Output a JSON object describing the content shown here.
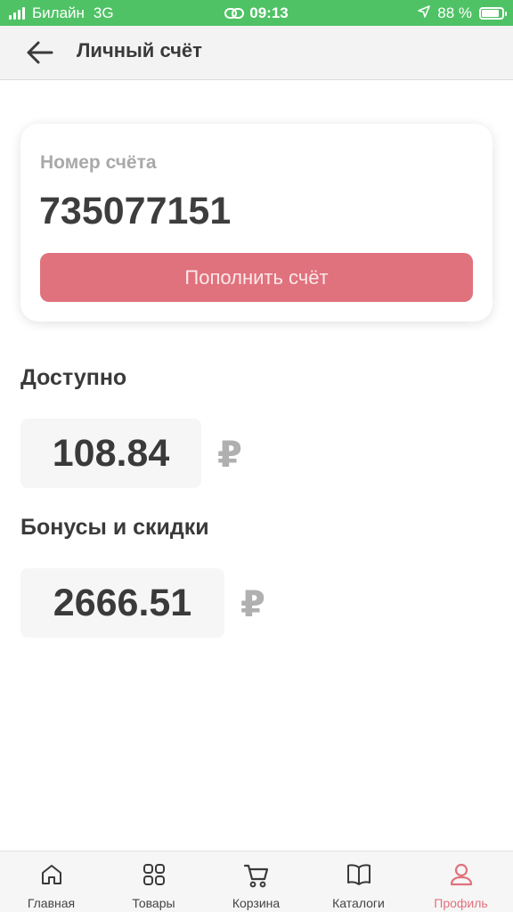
{
  "status_bar": {
    "carrier": "Билайн",
    "network": "3G",
    "time": "09:13",
    "battery_percent": "88 %",
    "battery_level": 0.88
  },
  "header": {
    "title": "Личный счёт",
    "back_icon": "arrow-left-icon"
  },
  "account": {
    "label": "Номер счёта",
    "number": "735077151",
    "topup_label": "Пополнить счёт"
  },
  "available": {
    "title": "Доступно",
    "amount": "108.84",
    "currency": "₽"
  },
  "bonuses": {
    "title": "Бонусы и скидки",
    "amount": "2666.51",
    "currency": "₽"
  },
  "nav": {
    "items": [
      {
        "label": "Главная",
        "icon": "home-icon"
      },
      {
        "label": "Товары",
        "icon": "grid-icon"
      },
      {
        "label": "Корзина",
        "icon": "cart-icon"
      },
      {
        "label": "Каталоги",
        "icon": "book-icon"
      },
      {
        "label": "Профиль",
        "icon": "profile-icon"
      }
    ],
    "active_index": 4
  },
  "colors": {
    "status_bar": "#4fc265",
    "accent": "#e0727d",
    "header_bg": "#f3f3f3"
  }
}
